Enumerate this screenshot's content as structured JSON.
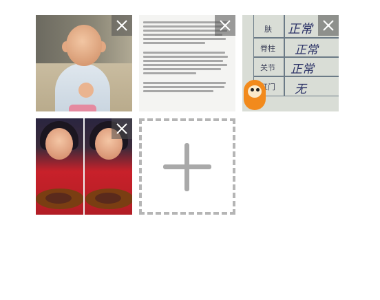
{
  "photos": [
    {
      "subject": "toddler-photo",
      "close_icon": "close-icon"
    },
    {
      "subject": "document-photo",
      "close_icon": "close-icon"
    },
    {
      "subject": "handwritten-form-photo",
      "close_icon": "close-icon",
      "form_labels": [
        "肤",
        "脊柱",
        "关节",
        "肛门"
      ],
      "handwriting": [
        "正常",
        "正常",
        "正常",
        "无"
      ]
    },
    {
      "subject": "girl-eating-photo",
      "close_icon": "close-icon"
    }
  ],
  "add_button": {
    "icon": "plus-icon"
  },
  "colors": {
    "close_bg": "#505050",
    "dashed_border": "#b5b5b5",
    "plus": "#a9a9a9"
  }
}
